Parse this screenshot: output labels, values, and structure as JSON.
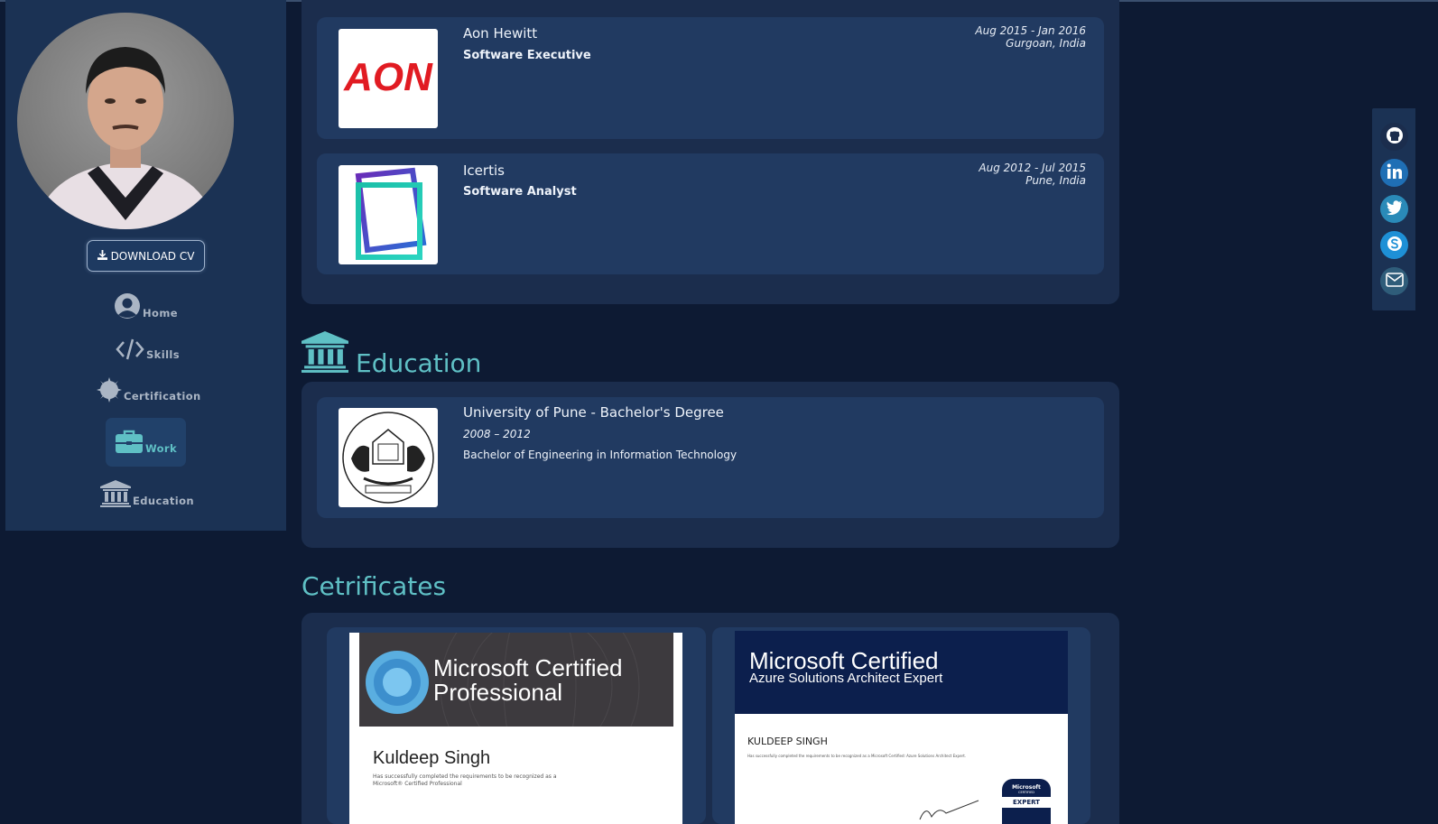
{
  "sidebar": {
    "download_cv": "DOWNLOAD CV",
    "nav": [
      {
        "label": "Home",
        "icon": "user-circle-icon"
      },
      {
        "label": "Skills",
        "icon": "code-icon"
      },
      {
        "label": "Certification",
        "icon": "certificate-icon"
      },
      {
        "label": "Work",
        "icon": "briefcase-icon",
        "active": true
      },
      {
        "label": "Education",
        "icon": "university-icon"
      }
    ]
  },
  "work": [
    {
      "company": "Aon Hewitt",
      "role": "Software Executive",
      "dates": "Aug 2015 - Jan 2016",
      "location": "Gurgoan, India",
      "logo_text": "AON"
    },
    {
      "company": "Icertis",
      "role": "Software Analyst",
      "dates": "Aug 2012 - Jul 2015",
      "location": "Pune, India"
    }
  ],
  "education": {
    "heading": "Education",
    "items": [
      {
        "title": "University of Pune - Bachelor's Degree",
        "years": "2008 – 2012",
        "description": "Bachelor of Engineering in Information Technology"
      }
    ]
  },
  "certificates": {
    "heading": "Cetrificates",
    "items": [
      {
        "title_line1": "Microsoft Certified",
        "title_line2": "Professional",
        "name": "Kuldeep Singh",
        "text": "Has successfully completed the requirements to be recognized as a Microsoft® Certified Professional"
      },
      {
        "title_line1": "Microsoft Certified",
        "title_line2": "Azure Solutions Architect Expert",
        "name": "KULDEEP SINGH",
        "text": "Has successfully completed the requirements to be recognized as a Microsoft Certified: Azure Solutions Architect Expert.",
        "badge_brand": "Microsoft",
        "badge_sub": "CERTIFIED",
        "badge_level": "EXPERT"
      }
    ]
  },
  "social": [
    {
      "name": "github",
      "icon": "github-icon",
      "color": "#1b2d4d"
    },
    {
      "name": "linkedin",
      "icon": "linkedin-icon",
      "color": "#1f6fb5"
    },
    {
      "name": "twitter",
      "icon": "twitter-icon",
      "color": "#2a8ab8"
    },
    {
      "name": "skype",
      "icon": "skype-icon",
      "color": "#1e90d6"
    },
    {
      "name": "email",
      "icon": "envelope-icon",
      "color": "#2f5d7a"
    }
  ],
  "colors": {
    "accent": "#5fc0c5",
    "background": "#0d1a33",
    "panel": "#1b2d4d",
    "card": "#213a61"
  }
}
